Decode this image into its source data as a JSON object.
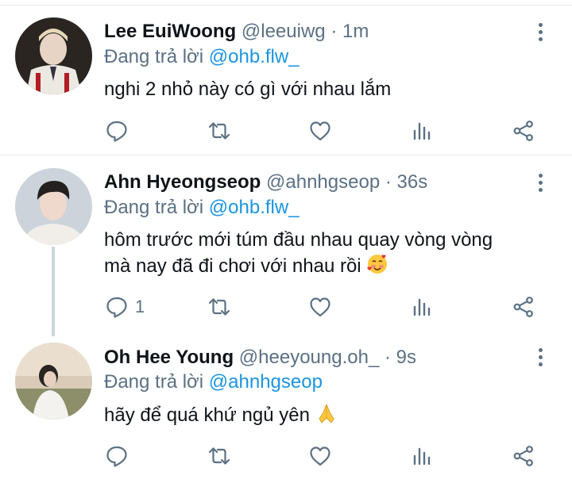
{
  "tweets": [
    {
      "name": "Lee EuiWoong",
      "handle": "@leeuiwg",
      "time": "· 1m",
      "replying_prefix": "Đang trả lời ",
      "replying_to": "@ohb.flw_",
      "lines": [
        "nghi 2 nhỏ này có gì với nhau lắm"
      ],
      "reply_count": ""
    },
    {
      "name": "Ahn Hyeongseop",
      "handle": "@ahnhgseop",
      "time": "· 36s",
      "replying_prefix": "Đang trả lời ",
      "replying_to": "@ohb.flw_",
      "lines": [
        "hôm trước mới túm đầu nhau quay vòng vòng",
        "mà nay đã đi chơi với nhau rồi"
      ],
      "reply_count": "1"
    },
    {
      "name": "Oh Hee Young",
      "handle": "@heeyoung.oh_",
      "time": "· 9s",
      "replying_prefix": "Đang trả lời ",
      "replying_to": "@ahnhgseop",
      "lines": [
        "hãy để quá khứ ngủ yên"
      ],
      "reply_count": ""
    }
  ],
  "icons": [
    "reply-icon",
    "retweet-icon",
    "like-icon",
    "analytics-icon",
    "share-icon",
    "more-icon"
  ],
  "colors": {
    "text": "#0f1419",
    "muted": "#5b7083",
    "link": "#1b95e0",
    "divider": "#e6ecf0"
  }
}
